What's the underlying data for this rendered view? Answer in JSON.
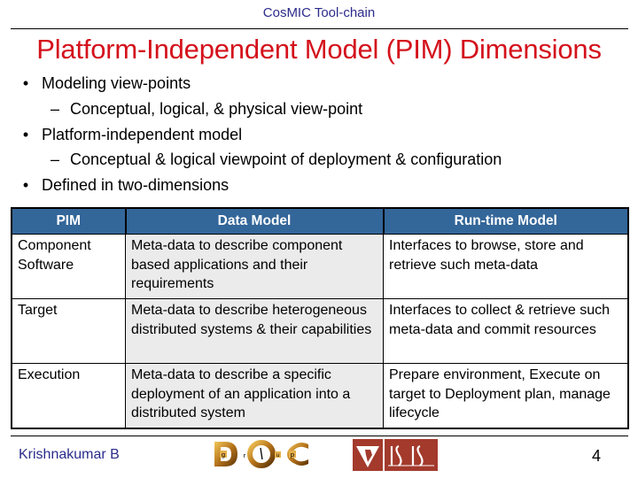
{
  "header": {
    "top_label": "CosMIC Tool-chain",
    "title": "Platform-Independent Model (PIM) Dimensions"
  },
  "bullets": [
    {
      "level": 1,
      "marker": "•",
      "text": "Modeling view-points"
    },
    {
      "level": 2,
      "marker": "–",
      "text": "Conceptual, logical, & physical view-point"
    },
    {
      "level": 1,
      "marker": "•",
      "text": "Platform-independent model"
    },
    {
      "level": 2,
      "marker": "–",
      "text": "Conceptual & logical viewpoint of deployment & configuration"
    },
    {
      "level": 1,
      "marker": "•",
      "text": "Defined in two-dimensions"
    }
  ],
  "table": {
    "headers": [
      "PIM",
      "Data Model",
      "Run-time Model"
    ],
    "rows": [
      [
        "Component Software",
        "Meta-data to describe component based applications and their requirements",
        "Interfaces to browse, store and retrieve such meta-data"
      ],
      [
        "Target",
        "Meta-data to describe heterogeneous distributed systems & their capabilities",
        "Interfaces to collect & retrieve such meta-data and commit resources"
      ],
      [
        "Execution",
        "Meta-data to describe a specific deployment of an application into a distributed system",
        "Prepare environment, Execute on target to Deployment plan, manage lifecycle"
      ]
    ],
    "colors": {
      "header_bg": "#336699",
      "data_model_bg": "#ebebeb"
    }
  },
  "footer": {
    "author": "Krishnakumar B",
    "page_number": "4",
    "logos": [
      {
        "name": "doc-group-logo",
        "letters": [
          "D",
          "g",
          "r",
          "O",
          "u",
          "p",
          "C"
        ]
      },
      {
        "name": "vanderbilt-isis-logo",
        "letters": [
          "V",
          "ISIS"
        ]
      }
    ]
  },
  "colors": {
    "title": "#d4121c",
    "top_label": "#2b2b8c",
    "author": "#2b2b8c"
  }
}
